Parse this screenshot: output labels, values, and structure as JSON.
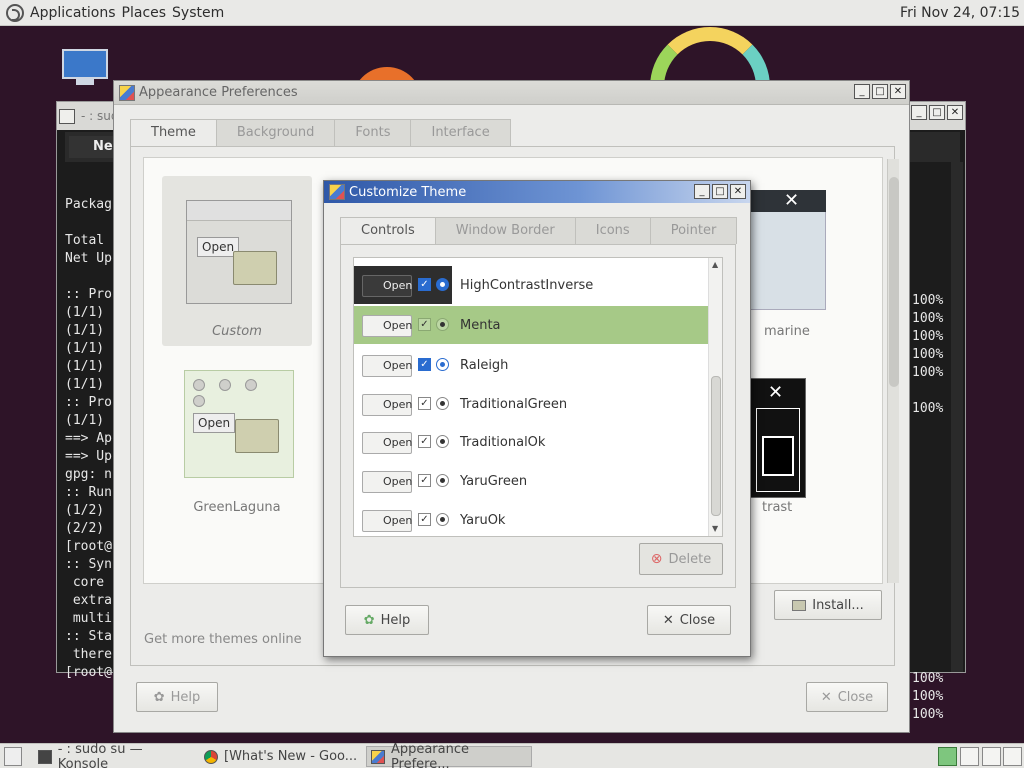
{
  "top_panel": {
    "menus": [
      "Applications",
      "Places",
      "System"
    ],
    "clock": "Fri Nov 24, 07:15"
  },
  "konsole": {
    "title": "- : sudo su",
    "tab_label": "New",
    "terminal_lines": [
      "",
      "Packag",
      "",
      "Total",
      "Net Up",
      "",
      ":: Pro",
      "(1/1)",
      "(1/1)",
      "(1/1)",
      "(1/1)",
      "(1/1)",
      ":: Pro",
      "(1/1)",
      "==> Ap",
      "==> Up",
      "gpg: n",
      ":: Run",
      "(1/2)",
      "(2/2)",
      "[root@",
      ":: Syn",
      " core",
      " extra",
      " multi",
      ":: Sta",
      " there",
      "[root@"
    ],
    "percent_lines": [
      "100%",
      "100%",
      "100%",
      "100%",
      "100%",
      "",
      "100%",
      "",
      "",
      "",
      "",
      "",
      "",
      "",
      "",
      "",
      "",
      "",
      "",
      "",
      "",
      "100%",
      "100%",
      "100%"
    ]
  },
  "appearance": {
    "title": "Appearance Preferences",
    "tabs": [
      "Theme",
      "Background",
      "Fonts",
      "Interface"
    ],
    "themes": [
      {
        "label": "Custom",
        "button": "Open"
      },
      {
        "label": "GreenLaguna",
        "button": "Open"
      },
      {
        "label": "marine"
      },
      {
        "label": "trast"
      }
    ],
    "get_more_link": "Get more themes online",
    "install_button": "Install...",
    "help_button": "Help",
    "close_button": "Close"
  },
  "customize": {
    "title": "Customize Theme",
    "tabs": [
      "Controls",
      "Window Border",
      "Icons",
      "Pointer"
    ],
    "preview_button": "Open",
    "themes": [
      "HighContrastInverse",
      "Menta",
      "Raleigh",
      "TraditionalGreen",
      "TraditionalOk",
      "YaruGreen",
      "YaruOk"
    ],
    "selected": "Menta",
    "delete_button": "Delete",
    "help_button": "Help",
    "close_button": "Close"
  },
  "taskbar": {
    "items": [
      "- : sudo su — Konsole",
      "[What's New - Goo...",
      "Appearance Prefere..."
    ]
  },
  "colors": {
    "selection": "#a6c987",
    "dialog_title": "#2f58a8"
  }
}
